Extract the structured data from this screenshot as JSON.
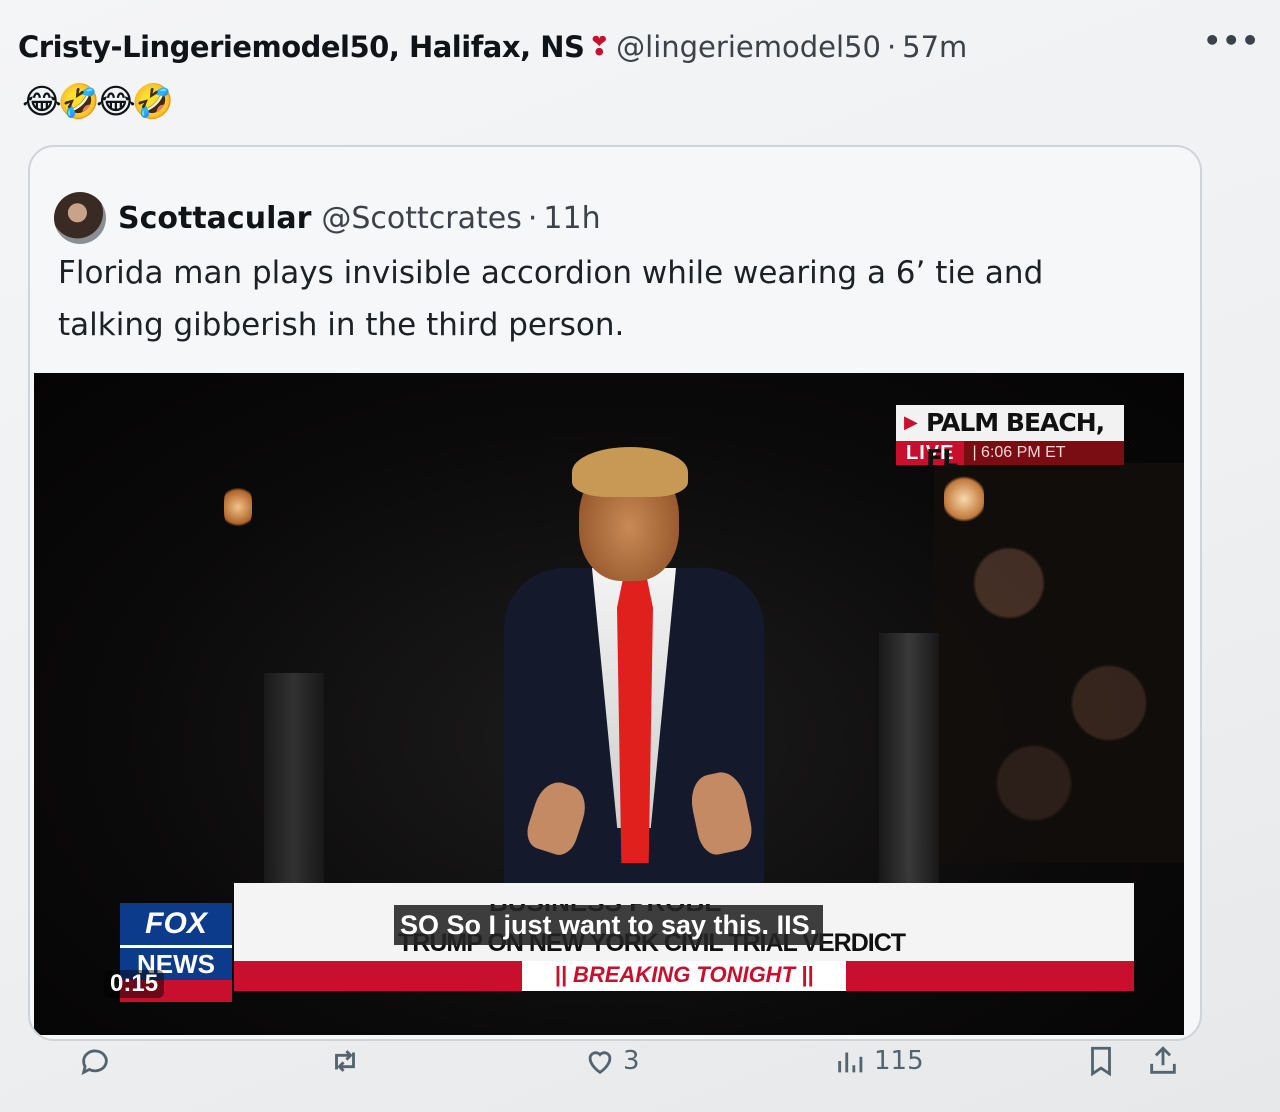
{
  "post": {
    "author_name": "Cristy-Lingeriemodel50, Halifax, NS",
    "author_emoji": "❣",
    "handle": "@lingeriemodel50",
    "separator": "·",
    "time": "57m",
    "text": "😂🤣😂🤣"
  },
  "quoted_post": {
    "name": "Scottacular",
    "handle": "@Scottcrates",
    "separator": "·",
    "time": "11h",
    "text": "Florida man plays invisible accordion while wearing a 6’ tie and talking gibberish in the third person."
  },
  "video": {
    "location": "PALM BEACH, FL",
    "live_label": "LIVE",
    "live_time": "| 6:06 PM ET",
    "lower_third_top": "BUSINESS PROBE",
    "headline": "TRUMP ON NEW YORK CIVIL TRIAL VERDICT",
    "breaking": "|| BREAKING TONIGHT ||",
    "caption": "SO So I just want to say this. IIS.",
    "network_logo_top": "FOX",
    "network_logo_bottom": "NEWS",
    "duration": "0:15"
  },
  "actions": {
    "reply_icon": "reply-icon",
    "retweet_icon": "retweet-icon",
    "like_icon": "heart-icon",
    "like_count": "3",
    "views_icon": "views-icon",
    "views_count": "115",
    "bookmark_icon": "bookmark-icon",
    "share_icon": "share-icon"
  },
  "colors": {
    "fox_blue": "#0d3b8c",
    "fox_red": "#c8102e",
    "muted_text": "#536471"
  }
}
